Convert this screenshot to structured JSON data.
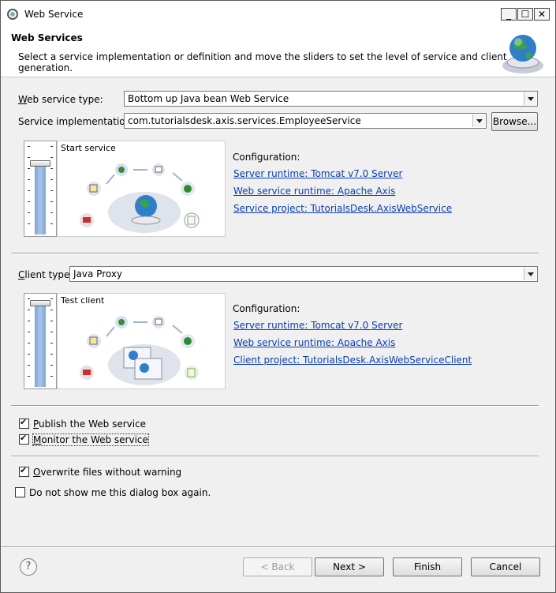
{
  "window": {
    "title": "Web Service"
  },
  "header": {
    "title": "Web Services",
    "description": "Select a service implementation or definition and move the sliders to set the level of service and client generation."
  },
  "service": {
    "type_label_accel": "W",
    "type_label_rest": "eb service type:",
    "type_value": "Bottom up Java bean Web Service",
    "impl_label": "Service implementation:",
    "impl_value": "com.tutorialsdesk.axis.services.EmployeeService",
    "browse_label": "Browse...",
    "slider_level_label": "Start service",
    "config_title": "Configuration:",
    "links": [
      "Server runtime: Tomcat v7.0 Server",
      "Web service runtime: Apache Axis",
      "Service project: TutorialsDesk.AxisWebService"
    ]
  },
  "client": {
    "type_label_accel": "C",
    "type_label_rest": "lient type:",
    "type_value": "Java Proxy",
    "slider_level_label": "Test client",
    "config_title": "Configuration:",
    "links": [
      "Server runtime: Tomcat v7.0 Server",
      "Web service runtime: Apache Axis",
      "Client project: TutorialsDesk.AxisWebServiceClient"
    ]
  },
  "options": [
    {
      "accel": "P",
      "rest": "ublish the Web service",
      "checked": true
    },
    {
      "accel": "M",
      "rest": "onitor the Web service",
      "checked": true
    },
    {
      "accel": "O",
      "rest": "verwrite files without warning",
      "checked": true
    },
    {
      "accel": "",
      "rest": "Do not show me this dialog box again.",
      "checked": false
    }
  ],
  "footer": {
    "help_glyph": "?",
    "back_label": "< Back",
    "next_label": "Next >",
    "finish_label": "Finish",
    "cancel_label": "Cancel"
  },
  "icons": {
    "window_controls": [
      "minimize-icon",
      "maximize-icon",
      "close-icon"
    ],
    "glyphs": {
      "minimize": "_",
      "maximize": "☐",
      "close": "✕"
    }
  }
}
